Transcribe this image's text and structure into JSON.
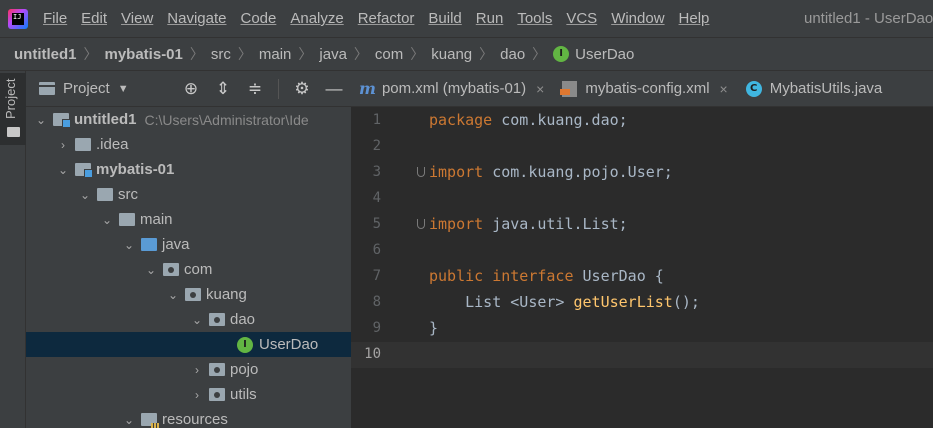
{
  "menubar": {
    "items": [
      "File",
      "Edit",
      "View",
      "Navigate",
      "Code",
      "Analyze",
      "Refactor",
      "Build",
      "Run",
      "Tools",
      "VCS",
      "Window",
      "Help"
    ],
    "window_title": "untitled1 - UserDao"
  },
  "breadcrumb": {
    "items": [
      "untitled1",
      "mybatis-01",
      "src",
      "main",
      "java",
      "com",
      "kuang",
      "dao",
      "UserDao"
    ]
  },
  "stripe": {
    "label": "Project"
  },
  "project_panel": {
    "title": "Project",
    "tree": [
      {
        "label": "untitled1",
        "path": "C:\\Users\\Administrator\\Ide"
      },
      {
        "label": ".idea"
      },
      {
        "label": "mybatis-01"
      },
      {
        "label": "src"
      },
      {
        "label": "main"
      },
      {
        "label": "java"
      },
      {
        "label": "com"
      },
      {
        "label": "kuang"
      },
      {
        "label": "dao"
      },
      {
        "label": "UserDao"
      },
      {
        "label": "pojo"
      },
      {
        "label": "utils"
      },
      {
        "label": "resources"
      }
    ]
  },
  "tabs": [
    {
      "label": "pom.xml (mybatis-01)"
    },
    {
      "label": "mybatis-config.xml"
    },
    {
      "label": "MybatisUtils.java"
    }
  ],
  "editor": {
    "line_numbers": [
      "1",
      "2",
      "3",
      "4",
      "5",
      "6",
      "7",
      "8",
      "9",
      "10"
    ],
    "lines": {
      "l1": {
        "kw": "package",
        "rest": " com.kuang.dao;"
      },
      "l3": {
        "kw": "import",
        "rest": " com.kuang.pojo.User;"
      },
      "l5": {
        "kw": "import",
        "rest": " java.util.List;"
      },
      "l7": {
        "kw": "public interface",
        "name": "UserDao",
        "rest": " {"
      },
      "l8": {
        "type": "List <User> ",
        "method": "getUserList",
        "rest": "();"
      },
      "l9": {
        "rest": "}"
      }
    }
  },
  "colors": {
    "keyword": "#cc7832",
    "method": "#ffc66d",
    "text": "#a9b7c6",
    "selection": "#0d293e",
    "class_icon": "#62b543"
  }
}
